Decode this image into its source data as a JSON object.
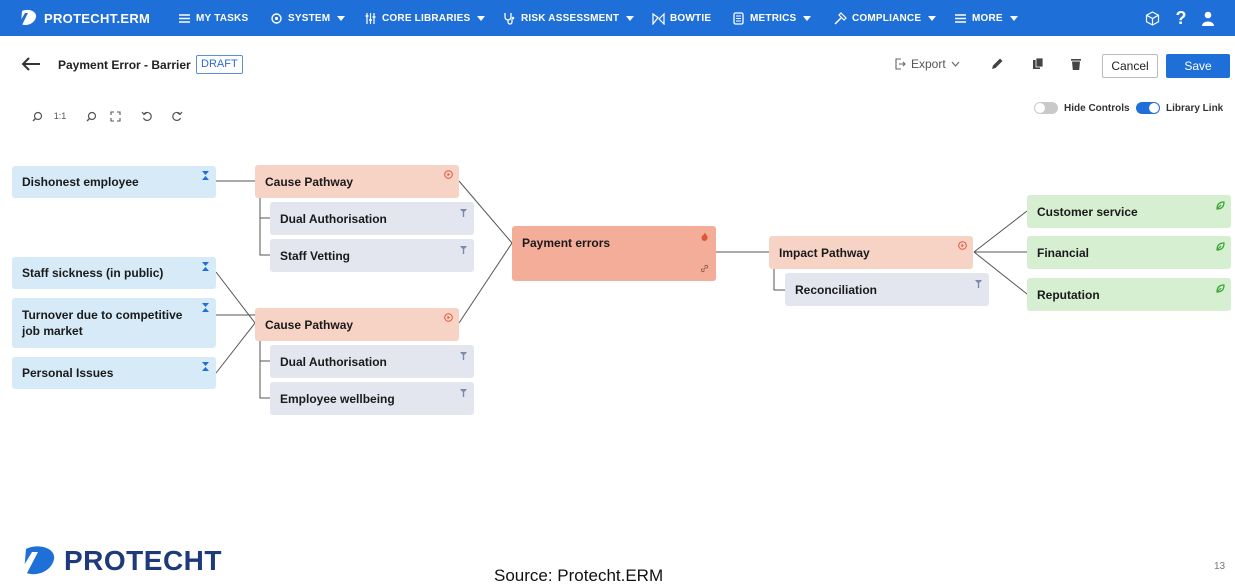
{
  "app": {
    "brand": "PROTECHT.ERM"
  },
  "topnav": {
    "items": [
      {
        "label": "MY TASKS",
        "icon": "list-icon",
        "caret": false
      },
      {
        "label": "SYSTEM",
        "icon": "gear-icon",
        "caret": true
      },
      {
        "label": "CORE LIBRARIES",
        "icon": "sliders-icon",
        "caret": true
      },
      {
        "label": "RISK ASSESSMENT",
        "icon": "stethoscope-icon",
        "caret": true
      },
      {
        "label": "BOWTIE",
        "icon": "bowtie-icon",
        "caret": false
      },
      {
        "label": "METRICS",
        "icon": "metrics-icon",
        "caret": true
      },
      {
        "label": "COMPLIANCE",
        "icon": "gavel-icon",
        "caret": true
      },
      {
        "label": "MORE",
        "icon": "menu-icon",
        "caret": true
      }
    ],
    "right_icons": [
      "cube-icon",
      "help-icon",
      "user-icon"
    ]
  },
  "header": {
    "title": "Payment Error - Barrier",
    "status_badge": "DRAFT",
    "export_label": "Export",
    "cancel_label": "Cancel",
    "save_label": "Save"
  },
  "zoom_controls": {
    "reset_label": "1:1"
  },
  "toggles": {
    "hide_controls": {
      "label": "Hide Controls",
      "on": false
    },
    "library_link": {
      "label": "Library Link",
      "on": true
    }
  },
  "colors": {
    "brand_blue": "#1f6fd8",
    "cause": "#d6ebf7",
    "pathway": "#f7d3c6",
    "control": "#e3e6ee",
    "event": "#f3ad98",
    "impact": "#d5efd0"
  },
  "bowtie": {
    "causes": [
      {
        "label": "Dishonest employee"
      },
      {
        "label": "Staff sickness (in public)"
      },
      {
        "label": "Turnover due to  competitive job market"
      },
      {
        "label": "Personal Issues"
      }
    ],
    "cause_pathways": [
      {
        "label": "Cause Pathway",
        "controls": [
          {
            "label": "Dual Authorisation"
          },
          {
            "label": "Staff Vetting"
          }
        ]
      },
      {
        "label": "Cause Pathway",
        "controls": [
          {
            "label": "Dual Authorisation"
          },
          {
            "label": "Employee wellbeing"
          }
        ]
      }
    ],
    "event": {
      "label": "Payment errors"
    },
    "impact_pathway": {
      "label": "Impact Pathway",
      "controls": [
        {
          "label": "Reconciliation"
        }
      ]
    },
    "impacts": [
      {
        "label": "Customer service"
      },
      {
        "label": "Financial"
      },
      {
        "label": "Reputation"
      }
    ]
  },
  "footer": {
    "logo_text": "PROTECHT",
    "source": "Source: Protecht.ERM",
    "page_number": "13"
  }
}
